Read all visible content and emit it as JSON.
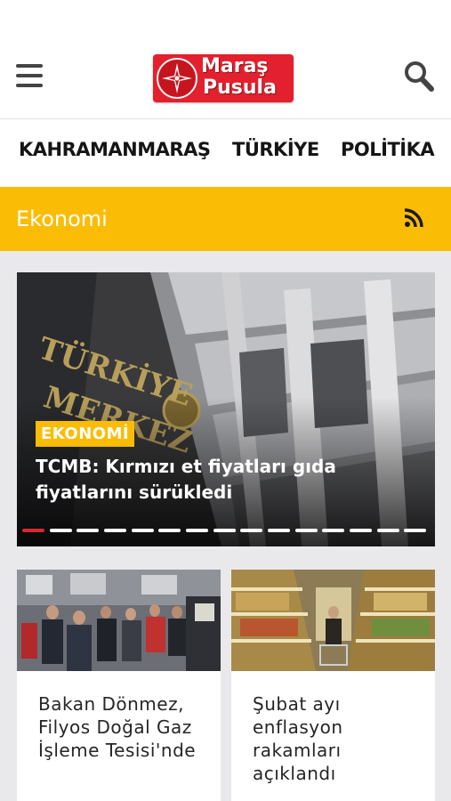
{
  "header": {
    "menu_icon": "hamburger-icon",
    "logo_line1": "Maraş",
    "logo_line2": "Pusula",
    "search_icon": "search-icon"
  },
  "categories": [
    "KAHRAMANMARAŞ",
    "TÜRKİYE",
    "POLİTİKA"
  ],
  "section": {
    "title": "Ekonomi",
    "rss_icon": "rss-icon",
    "accent": "#fbbc05"
  },
  "slider": {
    "badge": "EKONOMİ",
    "title": "TCMB: Kırmızı et fiyatları gıda fiyatlarını sürükledi",
    "photo_text_line1": "TÜRKİYE",
    "photo_text_line2": "MERKEZ",
    "slide_count": 15,
    "active_slide": 1
  },
  "cards": [
    {
      "title": "Bakan Dönmez, Filyos Doğal Gaz İşleme Tesisi'nde"
    },
    {
      "title": "Şubat ayı enflasyon rakamları açıklandı"
    }
  ],
  "colors": {
    "brand_red": "#e3202d",
    "active_dot": "#d9262f"
  }
}
